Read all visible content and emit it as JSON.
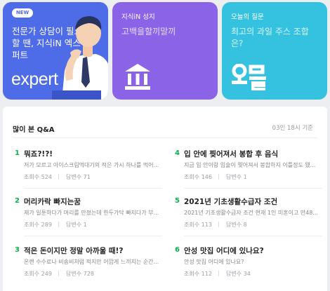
{
  "cards": {
    "expert": {
      "badge": "NEW",
      "title": "전문가 상담이 필요할 땐, 지식iN 엑스퍼트",
      "logo_text": "expert",
      "bg": "#4f6ce8"
    },
    "sanctuary": {
      "heading": "지식iN 성지",
      "text": "고백을할끼말끼",
      "icon": "bank-icon",
      "bg": "#8b63e6"
    },
    "today": {
      "heading": "오늘의 질문",
      "text": "최고의 과일 주스 조합은?",
      "icon_text": "오늘",
      "bg": "#35c2e0"
    }
  },
  "popular": {
    "title": "많이 본 Q&A",
    "time": "03인 18시 기준",
    "accent": "#0db14b",
    "views_label": "조회수",
    "answers_label": "답변수",
    "items": [
      {
        "rank": "1",
        "title": "뭐죠?!?!",
        "snippet": "저가 모르고 아이스크림먹대기의 적은 가시 하나를 먹어...",
        "views": "524",
        "answers": "71"
      },
      {
        "rank": "2",
        "title": "머리카락 빠지는꿈",
        "snippet": "제가 일툰하다가 머리를 만졌는데 한두가닥 빠지다가 부...",
        "views": "289",
        "answers": "1"
      },
      {
        "rank": "3",
        "title": "적은 돈이지만 정말 아까울 때!?",
        "snippet": "온랜 수수료나 비송비처럼 적지만 어깝게 느끼지는 순간...",
        "views": "249",
        "answers": "728"
      },
      {
        "rank": "4",
        "title": "입 안에 찢어져서 봉합 후 음식",
        "snippet": "지금 입 안이랑 입술이 찢어져서 봉합하지 이틀정도 됐...",
        "views": "146",
        "answers": "1"
      },
      {
        "rank": "5",
        "title": "2021년 기초생활수급자 조건",
        "snippet": "2021년 기초생활수급자 조건 현재 1인 미혼이고 만48...",
        "views": "113",
        "answers": "8"
      },
      {
        "rank": "6",
        "title": "안성 맛집 어디에 있나요?",
        "snippet": "안성 맛집 어디에 있나요?",
        "views": "112",
        "answers": "34"
      }
    ]
  }
}
